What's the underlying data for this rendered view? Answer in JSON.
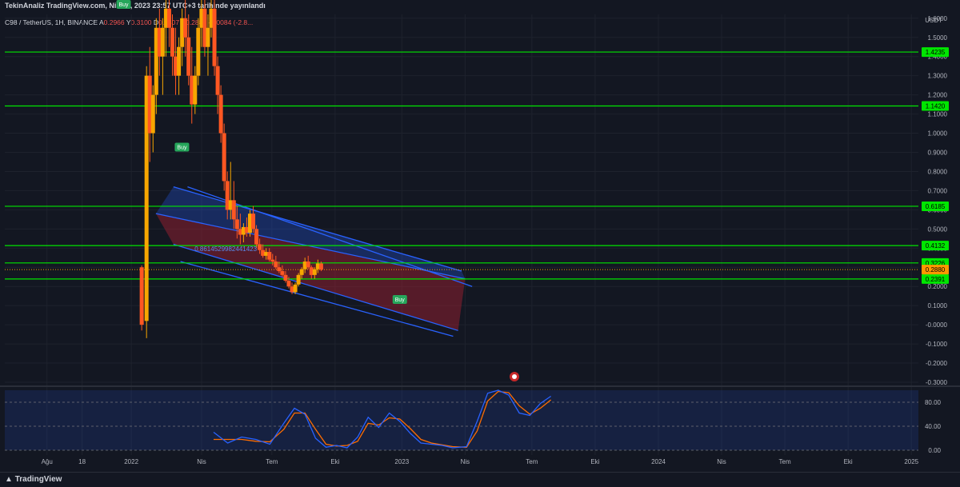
{
  "header": {
    "publish_line": "TekinAnaliz TradingView.com, Nis 17, 2023 23:57 UTC+3 tarihinde yayınlandı"
  },
  "info": {
    "symbol": "C98 / TetherUS, 1H, BINANCE",
    "a_label": "A",
    "a_value": "0.2966",
    "y_label": "Y",
    "y_value": "0.3100",
    "d_label": "D",
    "d_value": "0.2807",
    "k_label": "K",
    "k_value": "0.2880",
    "change": "-0.0084 (-2.8..."
  },
  "unit": "USDT",
  "footer": {
    "brand": "TradingView"
  },
  "colors": {
    "bg": "#131722",
    "grid": "#1e222d",
    "up": "#f7a600",
    "down": "#ff5722",
    "hline": "#00e600",
    "channel": "#2962ff",
    "rsi_k": "#2962ff",
    "rsi_d": "#ff6d00",
    "buy": "#26a65b",
    "current": "#ff9800"
  },
  "chart_data": {
    "type": "candlestick",
    "y_axis": {
      "ticks": [
        "1.6000",
        "1.5000",
        "1.4000",
        "1.3000",
        "1.2000",
        "1.1000",
        "1.0000",
        "0.9000",
        "0.8000",
        "0.7000",
        "0.6000",
        "0.5000",
        "0.4000",
        "0.3000",
        "0.2000",
        "0.1000",
        "-0.0000",
        "-0.1000",
        "-0.2000",
        "-0.3000"
      ],
      "range": [
        -0.3,
        1.62
      ]
    },
    "x_axis": {
      "ticks": [
        {
          "label": "Ağu",
          "t": 0.06
        },
        {
          "label": "18",
          "t": 0.11
        },
        {
          "label": "2022",
          "t": 0.18
        },
        {
          "label": "Nis",
          "t": 0.28
        },
        {
          "label": "Tem",
          "t": 0.38
        },
        {
          "label": "Eki",
          "t": 0.47
        },
        {
          "label": "2023",
          "t": 0.565
        },
        {
          "label": "Nis",
          "t": 0.655
        },
        {
          "label": "Tem",
          "t": 0.75
        },
        {
          "label": "Eki",
          "t": 0.84
        },
        {
          "label": "2024",
          "t": 0.93
        },
        {
          "label": "Nis",
          "t": 1.02
        },
        {
          "label": "Tem",
          "t": 1.11
        },
        {
          "label": "Eki",
          "t": 1.2
        },
        {
          "label": "2025",
          "t": 1.29
        }
      ]
    },
    "horizontal_levels": [
      {
        "value": 1.4235,
        "label": "1.4235"
      },
      {
        "value": 1.142,
        "label": "1.1420"
      },
      {
        "value": 0.6185,
        "label": "0.6185"
      },
      {
        "value": 0.4132,
        "label": "0.4132"
      },
      {
        "value": 0.3226,
        "label": "0.3226"
      },
      {
        "value": 0.2391,
        "label": "0.2391"
      }
    ],
    "current_price": {
      "value": 0.288,
      "label": "0.2880"
    },
    "fib_label": {
      "text": "0.8614529982441423",
      "t": 0.245,
      "value": 0.385
    },
    "buy_signals": [
      {
        "label": "Buy",
        "t": 0.152,
        "value": 1.67
      },
      {
        "label": "Buy",
        "t": 0.235,
        "value": 0.925
      },
      {
        "label": "Buy",
        "t": 0.545,
        "value": 0.13
      }
    ],
    "channel": {
      "upper": [
        {
          "t": 0.24,
          "value": 0.72
        },
        {
          "t": 0.65,
          "value": 0.28
        }
      ],
      "upper2": [
        {
          "t": 0.26,
          "value": 0.72
        },
        {
          "t": 0.665,
          "value": 0.2
        }
      ],
      "middle": [
        {
          "t": 0.215,
          "value": 0.58
        },
        {
          "t": 0.655,
          "value": 0.24
        }
      ],
      "lower": [
        {
          "t": 0.24,
          "value": 0.42
        },
        {
          "t": 0.645,
          "value": -0.03
        }
      ],
      "lower2": [
        {
          "t": 0.25,
          "value": 0.33
        },
        {
          "t": 0.638,
          "value": -0.06
        }
      ]
    },
    "candles_t0": 0.04,
    "candles_dt": 0.0046,
    "candles": [
      [
        0.3,
        0.31,
        -0.03,
        0.0
      ],
      [
        0.02,
        1.35,
        -0.07,
        1.3
      ],
      [
        1.3,
        1.45,
        0.85,
        1.0
      ],
      [
        1.0,
        1.25,
        0.9,
        1.2
      ],
      [
        1.2,
        1.6,
        1.1,
        1.55
      ],
      [
        1.55,
        1.65,
        1.3,
        1.4
      ],
      [
        1.4,
        1.6,
        1.2,
        1.55
      ],
      [
        1.55,
        1.7,
        1.4,
        1.65
      ],
      [
        1.65,
        1.7,
        1.45,
        1.55
      ],
      [
        1.55,
        1.62,
        1.3,
        1.4
      ],
      [
        1.4,
        1.55,
        1.2,
        1.3
      ],
      [
        1.3,
        1.5,
        1.2,
        1.45
      ],
      [
        1.45,
        1.65,
        1.35,
        1.6
      ],
      [
        1.6,
        1.7,
        1.4,
        1.5
      ],
      [
        1.5,
        1.62,
        1.25,
        1.3
      ],
      [
        1.3,
        1.45,
        1.05,
        1.15
      ],
      [
        1.15,
        1.35,
        1.1,
        1.3
      ],
      [
        1.3,
        1.6,
        1.25,
        1.55
      ],
      [
        1.55,
        1.7,
        1.45,
        1.65
      ],
      [
        1.65,
        1.7,
        1.4,
        1.45
      ],
      [
        1.45,
        1.62,
        1.3,
        1.55
      ],
      [
        1.55,
        1.7,
        1.5,
        1.65
      ],
      [
        1.65,
        1.7,
        1.3,
        1.35
      ],
      [
        1.35,
        1.4,
        1.1,
        1.2
      ],
      [
        1.2,
        1.25,
        0.95,
        1.0
      ],
      [
        1.0,
        1.05,
        0.7,
        0.75
      ],
      [
        0.75,
        0.8,
        0.55,
        0.6
      ],
      [
        0.6,
        0.85,
        0.55,
        0.65
      ],
      [
        0.65,
        0.75,
        0.5,
        0.55
      ],
      [
        0.55,
        0.62,
        0.45,
        0.5
      ],
      [
        0.5,
        0.58,
        0.42,
        0.47
      ],
      [
        0.47,
        0.53,
        0.43,
        0.51
      ],
      [
        0.51,
        0.56,
        0.46,
        0.48
      ],
      [
        0.48,
        0.6,
        0.46,
        0.58
      ],
      [
        0.58,
        0.62,
        0.48,
        0.5
      ],
      [
        0.5,
        0.52,
        0.4,
        0.42
      ],
      [
        0.42,
        0.45,
        0.37,
        0.39
      ],
      [
        0.39,
        0.42,
        0.35,
        0.36
      ],
      [
        0.36,
        0.4,
        0.34,
        0.38
      ],
      [
        0.38,
        0.4,
        0.33,
        0.34
      ],
      [
        0.34,
        0.37,
        0.31,
        0.33
      ],
      [
        0.33,
        0.36,
        0.29,
        0.3
      ],
      [
        0.3,
        0.33,
        0.27,
        0.28
      ],
      [
        0.28,
        0.31,
        0.25,
        0.26
      ],
      [
        0.26,
        0.28,
        0.22,
        0.23
      ],
      [
        0.23,
        0.25,
        0.19,
        0.2
      ],
      [
        0.2,
        0.22,
        0.16,
        0.17
      ],
      [
        0.17,
        0.22,
        0.16,
        0.21
      ],
      [
        0.21,
        0.27,
        0.2,
        0.26
      ],
      [
        0.26,
        0.3,
        0.24,
        0.29
      ],
      [
        0.29,
        0.35,
        0.27,
        0.33
      ],
      [
        0.33,
        0.36,
        0.29,
        0.3
      ],
      [
        0.3,
        0.31,
        0.24,
        0.26
      ],
      [
        0.26,
        0.3,
        0.24,
        0.29
      ],
      [
        0.29,
        0.34,
        0.27,
        0.32
      ],
      [
        0.32,
        0.33,
        0.28,
        0.288
      ]
    ],
    "rsi": {
      "levels": [
        {
          "value": 80,
          "label": "80.00"
        },
        {
          "value": 40,
          "label": "40.00"
        },
        {
          "value": 0,
          "label": "0.00"
        }
      ],
      "range": [
        0,
        100
      ],
      "k": [
        [
          0.14,
          30
        ],
        [
          0.16,
          12
        ],
        [
          0.18,
          22
        ],
        [
          0.2,
          18
        ],
        [
          0.22,
          10
        ],
        [
          0.24,
          45
        ],
        [
          0.255,
          70
        ],
        [
          0.27,
          60
        ],
        [
          0.285,
          20
        ],
        [
          0.3,
          5
        ],
        [
          0.315,
          8
        ],
        [
          0.33,
          4
        ],
        [
          0.345,
          22
        ],
        [
          0.36,
          55
        ],
        [
          0.375,
          38
        ],
        [
          0.39,
          62
        ],
        [
          0.405,
          48
        ],
        [
          0.42,
          28
        ],
        [
          0.435,
          12
        ],
        [
          0.45,
          10
        ],
        [
          0.465,
          8
        ],
        [
          0.48,
          4
        ],
        [
          0.5,
          6
        ],
        [
          0.515,
          48
        ],
        [
          0.53,
          95
        ],
        [
          0.545,
          100
        ],
        [
          0.56,
          92
        ],
        [
          0.575,
          62
        ],
        [
          0.59,
          58
        ],
        [
          0.605,
          78
        ],
        [
          0.62,
          90
        ]
      ],
      "d": [
        [
          0.14,
          18
        ],
        [
          0.16,
          18
        ],
        [
          0.18,
          18
        ],
        [
          0.2,
          15
        ],
        [
          0.22,
          14
        ],
        [
          0.24,
          35
        ],
        [
          0.255,
          62
        ],
        [
          0.27,
          62
        ],
        [
          0.285,
          35
        ],
        [
          0.3,
          10
        ],
        [
          0.315,
          7
        ],
        [
          0.33,
          8
        ],
        [
          0.345,
          15
        ],
        [
          0.36,
          45
        ],
        [
          0.375,
          42
        ],
        [
          0.39,
          54
        ],
        [
          0.405,
          52
        ],
        [
          0.42,
          36
        ],
        [
          0.435,
          18
        ],
        [
          0.45,
          12
        ],
        [
          0.465,
          9
        ],
        [
          0.48,
          6
        ],
        [
          0.5,
          5
        ],
        [
          0.515,
          32
        ],
        [
          0.53,
          82
        ],
        [
          0.545,
          98
        ],
        [
          0.56,
          96
        ],
        [
          0.575,
          74
        ],
        [
          0.59,
          60
        ],
        [
          0.605,
          70
        ],
        [
          0.62,
          84
        ]
      ]
    }
  }
}
